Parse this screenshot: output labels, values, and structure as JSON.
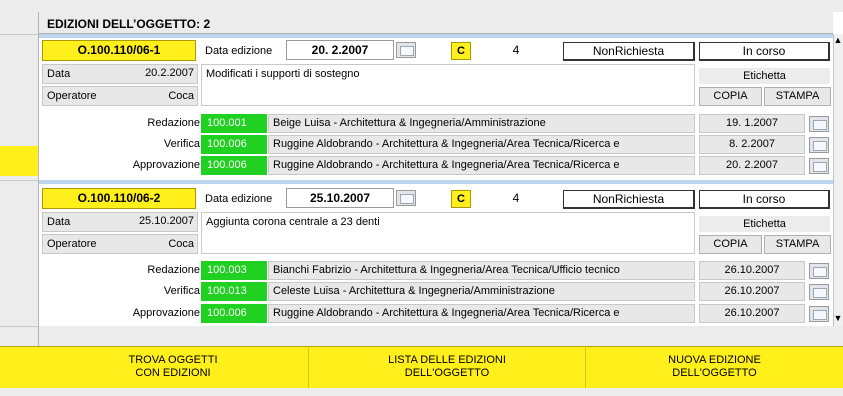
{
  "header": {
    "title": "EDIZIONI DELL’OGGETTO: 2"
  },
  "labels": {
    "data_edizione": "Data edizione",
    "data": "Data",
    "operatore": "Operatore",
    "etichetta": "Etichetta",
    "copia": "COPIA",
    "stampa": "STAMPA",
    "redazione": "Redazione",
    "verifica": "Verifica",
    "approvazione": "Approvazione"
  },
  "editions": [
    {
      "code": "O.100.110/06-1",
      "data_edizione": "20. 2.2007",
      "flag": "C",
      "number": "4",
      "richiesta": "NonRichiesta",
      "stato": "In corso",
      "data": "20.2.2007",
      "operatore": "Coca",
      "note": "Modificati i supporti di sostegno",
      "redazione": {
        "code": "100.001",
        "person": "Beige Luisa - Architettura & Ingegneria/Amministrazione",
        "date": "19. 1.2007"
      },
      "verifica": {
        "code": "100.006",
        "person": "Ruggine Aldobrando - Architettura & Ingegneria/Area Tecnica/Ricerca e",
        "date": "8. 2.2007"
      },
      "approvazione": {
        "code": "100.006",
        "person": "Ruggine Aldobrando - Architettura & Ingegneria/Area Tecnica/Ricerca e",
        "date": "20. 2.2007"
      }
    },
    {
      "code": "O.100.110/06-2",
      "data_edizione": "25.10.2007",
      "flag": "C",
      "number": "4",
      "richiesta": "NonRichiesta",
      "stato": "In corso",
      "data": "25.10.2007",
      "operatore": "Coca",
      "note": "Aggiunta corona centrale a 23 denti",
      "redazione": {
        "code": "100.003",
        "person": "Bianchi Fabrizio - Architettura & Ingegneria/Area Tecnica/Ufficio tecnico",
        "date": "26.10.2007"
      },
      "verifica": {
        "code": "100.013",
        "person": "Celeste Luisa - Architettura & Ingegneria/Amministrazione",
        "date": "26.10.2007"
      },
      "approvazione": {
        "code": "100.006",
        "person": "Ruggine Aldobrando - Architettura & Ingegneria/Area Tecnica/Ricerca e",
        "date": "26.10.2007"
      }
    }
  ],
  "footer": {
    "trova_line1": "TROVA OGGETTI",
    "trova_line2": "CON EDIZIONI",
    "lista_line1": "LISTA DELLE EDIZIONI",
    "lista_line2": "DELL'OGGETTO",
    "nuova_line1": "NUOVA EDIZIONE",
    "nuova_line2": "DELL'OGGETTO"
  },
  "colors": {
    "yellow": "#ffef1a",
    "green": "#21d121",
    "separator": "#bcd6f0"
  }
}
